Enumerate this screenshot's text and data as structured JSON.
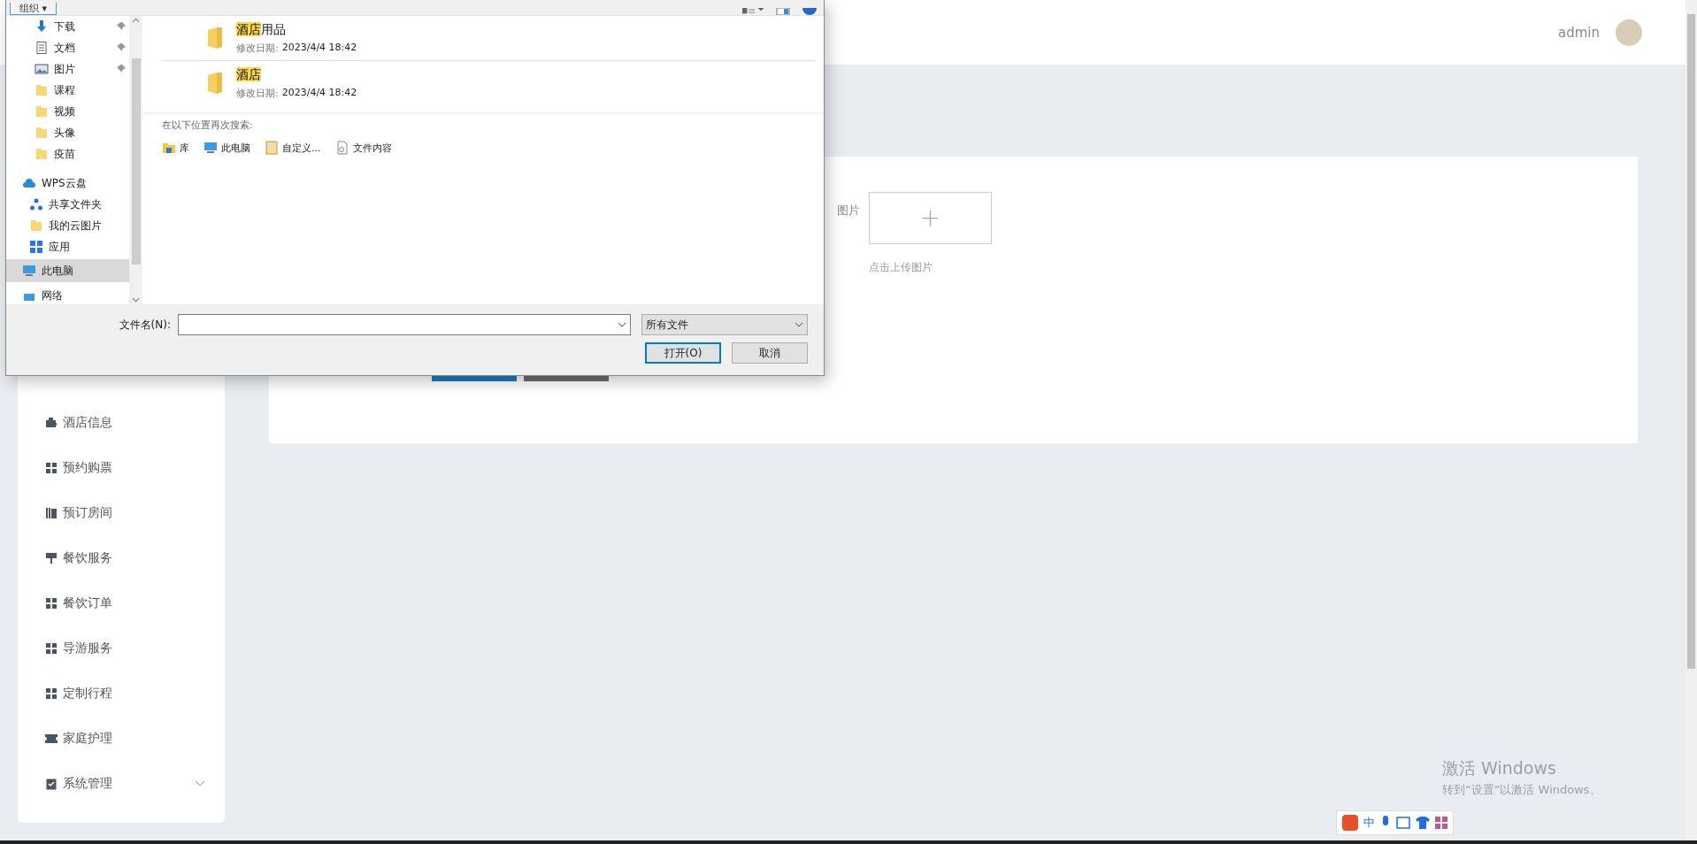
{
  "header": {
    "username": "admin"
  },
  "sidebar": {
    "items": [
      {
        "label": "酒店信息"
      },
      {
        "label": "预约购票"
      },
      {
        "label": "预订房间"
      },
      {
        "label": "餐饮服务"
      },
      {
        "label": "餐饮订单"
      },
      {
        "label": "导游服务"
      },
      {
        "label": "定制行程"
      },
      {
        "label": "家庭护理"
      },
      {
        "label": "系统管理",
        "expanded": false
      }
    ]
  },
  "form": {
    "image_label": "图片",
    "upload_button": "+",
    "upload_hint": "点击上传图片",
    "buttons": [
      {
        "kind": "primary"
      },
      {
        "kind": "secondary"
      }
    ]
  },
  "file_dialog": {
    "toolbar": {
      "organize_button": "组织 ▾"
    },
    "quick_access": [
      {
        "label": "下载",
        "pinned": true
      },
      {
        "label": "文档",
        "pinned": true
      },
      {
        "label": "图片",
        "pinned": true
      },
      {
        "label": "课程",
        "pinned": false
      },
      {
        "label": "视频",
        "pinned": false
      },
      {
        "label": "头像",
        "pinned": false
      },
      {
        "label": "疫苗",
        "pinned": false
      }
    ],
    "locations": [
      {
        "label": "WPS云盘",
        "selected": false,
        "children": [
          {
            "label": "共享文件夹",
            "selected": false
          },
          {
            "label": "我的云图片",
            "selected": false
          },
          {
            "label": "应用",
            "selected": false
          }
        ]
      },
      {
        "label": "此电脑",
        "selected": true
      },
      {
        "label": "网络",
        "selected": false
      }
    ],
    "results": [
      {
        "name_match": "酒店",
        "name_rest": "用品",
        "date_label": "修改日期:",
        "date": "2023/4/4 18:42"
      },
      {
        "name_match": "酒店",
        "date_label": "修改日期:",
        "date": "2023/4/4 18:42"
      }
    ],
    "search_again": {
      "title": "在以下位置再次搜索:",
      "links": [
        {
          "label": "库"
        },
        {
          "label": "此电脑"
        },
        {
          "label": "自定义..."
        },
        {
          "label": "文件内容"
        }
      ]
    },
    "filename_label": "文件名(N):",
    "file_type": "所有文件",
    "open_button": "打开(O)",
    "cancel_button": "取消"
  },
  "activation": {
    "title": "激活 Windows",
    "subtitle": "转到“设置”以激活 Windows。"
  },
  "ime_bar": {
    "mode": "中"
  }
}
